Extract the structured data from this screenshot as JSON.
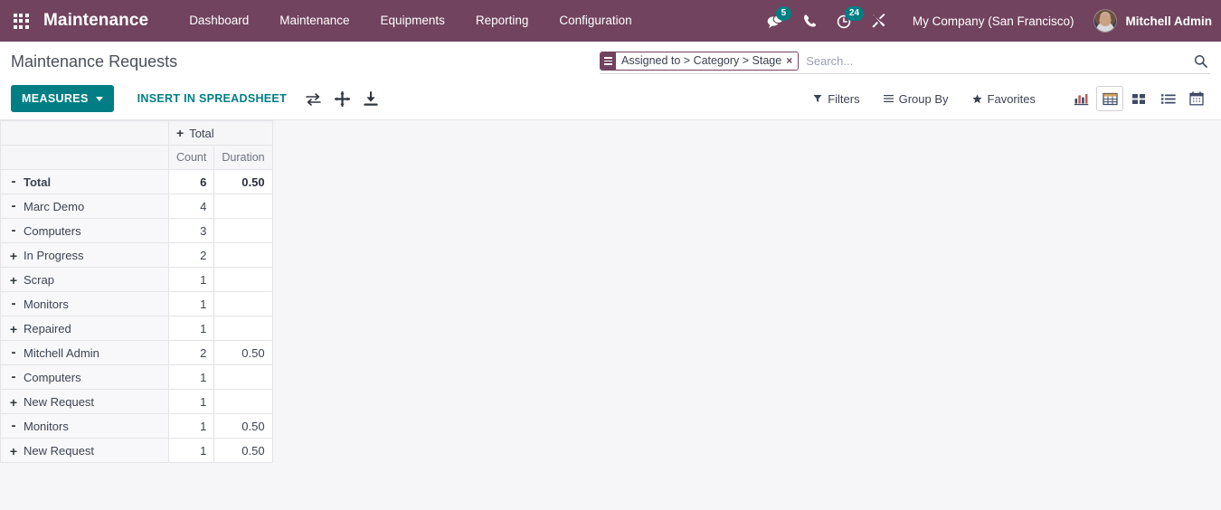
{
  "navbar": {
    "apps_icon": "apps-grid-icon",
    "brand": "Maintenance",
    "menu_items": [
      {
        "label": "Dashboard"
      },
      {
        "label": "Maintenance"
      },
      {
        "label": "Equipments"
      },
      {
        "label": "Reporting"
      },
      {
        "label": "Configuration"
      }
    ],
    "messages_badge": "5",
    "activities_badge": "24",
    "company": "My Company (San Francisco)",
    "username": "Mitchell Admin",
    "colors": {
      "navbar_bg": "#71435f",
      "badge_bg": "#017e84",
      "accent": "#017e84"
    }
  },
  "control_panel": {
    "page_title": "Maintenance Requests",
    "search": {
      "facet_label": "Assigned to > Category > Stage",
      "facet_remove": "×",
      "placeholder": "Search..."
    },
    "measures_label": "MEASURES",
    "spreadsheet_label": "INSERT IN SPREADSHEET",
    "icon_buttons": [
      {
        "name": "flip-axis-icon"
      },
      {
        "name": "expand-all-icon"
      },
      {
        "name": "download-xlsx-icon"
      }
    ],
    "filters_label": "Filters",
    "groupby_label": "Group By",
    "favorites_label": "Favorites",
    "views": [
      {
        "name": "graph",
        "active": false
      },
      {
        "name": "pivot",
        "active": true
      },
      {
        "name": "kanban",
        "active": false
      },
      {
        "name": "list",
        "active": false
      },
      {
        "name": "calendar",
        "active": false
      }
    ]
  },
  "pivot": {
    "column_group_label": "Total",
    "column_group_toggle": "+",
    "measures": [
      "Count",
      "Duration"
    ],
    "rows": [
      {
        "label": "Total",
        "level": 0,
        "toggle": "-",
        "count": "6",
        "duration": "0.50",
        "is_total": true
      },
      {
        "label": "Marc Demo",
        "level": 1,
        "toggle": "-",
        "count": "4",
        "duration": "",
        "is_total": false
      },
      {
        "label": "Computers",
        "level": 2,
        "toggle": "-",
        "count": "3",
        "duration": "",
        "is_total": false
      },
      {
        "label": "In Progress",
        "level": 3,
        "toggle": "+",
        "count": "2",
        "duration": "",
        "is_total": false
      },
      {
        "label": "Scrap",
        "level": 3,
        "toggle": "+",
        "count": "1",
        "duration": "",
        "is_total": false
      },
      {
        "label": "Monitors",
        "level": 2,
        "toggle": "-",
        "count": "1",
        "duration": "",
        "is_total": false
      },
      {
        "label": "Repaired",
        "level": 3,
        "toggle": "+",
        "count": "1",
        "duration": "",
        "is_total": false
      },
      {
        "label": "Mitchell Admin",
        "level": 1,
        "toggle": "-",
        "count": "2",
        "duration": "0.50",
        "is_total": false
      },
      {
        "label": "Computers",
        "level": 2,
        "toggle": "-",
        "count": "1",
        "duration": "",
        "is_total": false
      },
      {
        "label": "New Request",
        "level": 3,
        "toggle": "+",
        "count": "1",
        "duration": "",
        "is_total": false
      },
      {
        "label": "Monitors",
        "level": 2,
        "toggle": "-",
        "count": "1",
        "duration": "0.50",
        "is_total": false
      },
      {
        "label": "New Request",
        "level": 3,
        "toggle": "+",
        "count": "1",
        "duration": "0.50",
        "is_total": false
      }
    ]
  }
}
